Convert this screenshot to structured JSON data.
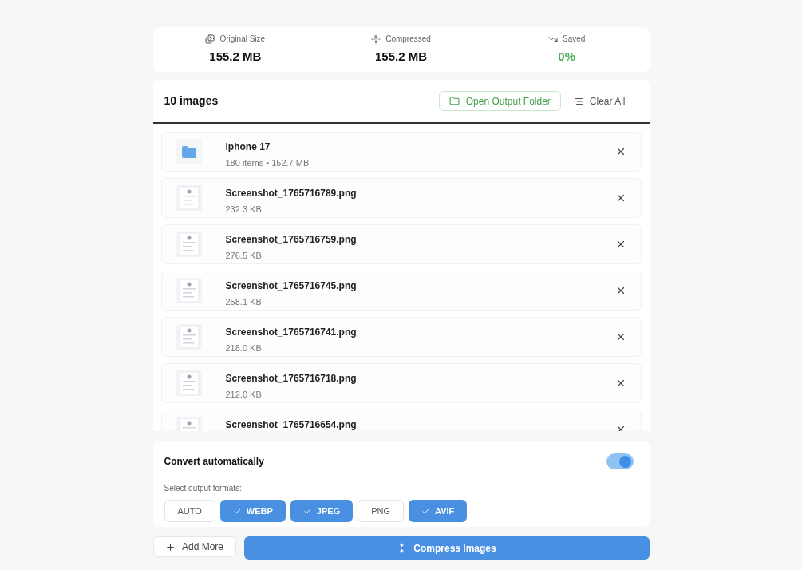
{
  "stats": [
    {
      "kind": "original",
      "label": "Original Size",
      "value": "155.2 MB"
    },
    {
      "kind": "compressed",
      "label": "Compressed",
      "value": "155.2 MB"
    },
    {
      "kind": "saved",
      "label": "Saved",
      "value": "0%"
    }
  ],
  "list": {
    "title": "10 images",
    "open_folder": "Open Output Folder",
    "clear_all": "Clear All",
    "items": [
      {
        "kind": "folder",
        "name": "iphone 17",
        "detail": "180 items • 152.7 MB"
      },
      {
        "name": "Screenshot_1765716789.png",
        "detail": "232.3 KB"
      },
      {
        "name": "Screenshot_1765716759.png",
        "detail": "276.5 KB"
      },
      {
        "name": "Screenshot_1765716745.png",
        "detail": "258.1 KB"
      },
      {
        "name": "Screenshot_1765716741.png",
        "detail": "218.0 KB"
      },
      {
        "name": "Screenshot_1765716718.png",
        "detail": "212.0 KB"
      },
      {
        "name": "Screenshot_1765716654.png"
      }
    ]
  },
  "settings": {
    "auto_label": "Convert automatically",
    "auto_on": true,
    "formats_label": "Select output formats:",
    "formats": [
      {
        "label": "AUTO",
        "selected": false
      },
      {
        "label": "WEBP",
        "selected": true
      },
      {
        "label": "JPEG",
        "selected": true
      },
      {
        "label": "PNG",
        "selected": false
      },
      {
        "label": "AVIF",
        "selected": true
      }
    ]
  },
  "actions": {
    "add_more": "Add More",
    "compress": "Compress Images"
  }
}
